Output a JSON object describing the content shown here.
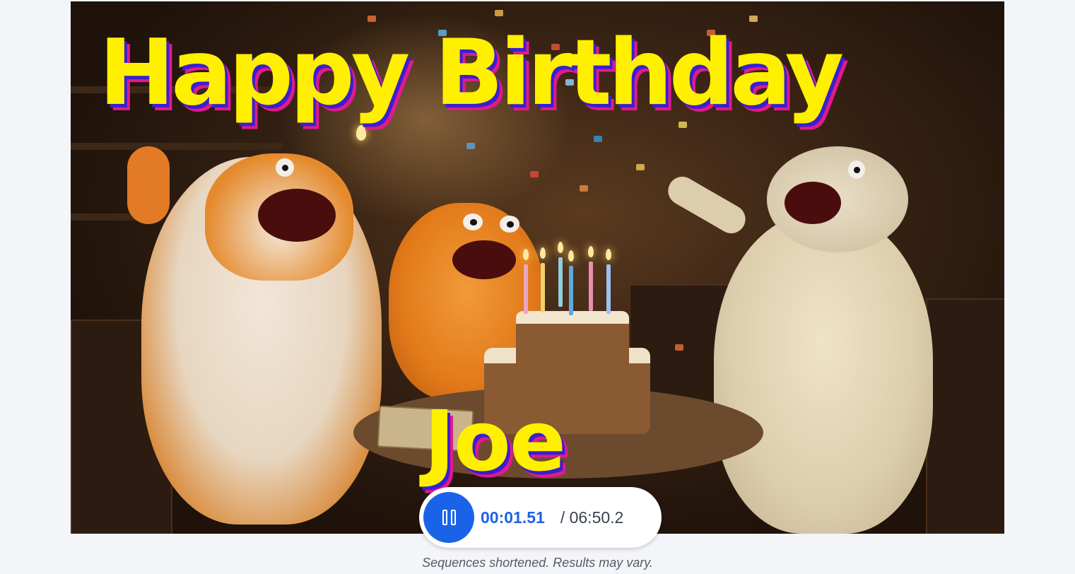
{
  "video": {
    "title_line": "Happy Birthday",
    "name_line": "Joe",
    "title_color": "#fff000",
    "title_shadow_colors": [
      "#3a1fd0",
      "#e01a8a"
    ]
  },
  "player": {
    "pause_icon": "pause-icon",
    "current_time": "00:01.51",
    "total_time": "/ 06:50.2",
    "accent_color": "#1a63e8"
  },
  "footer": {
    "disclaimer": "Sequences shortened. Results may vary."
  }
}
